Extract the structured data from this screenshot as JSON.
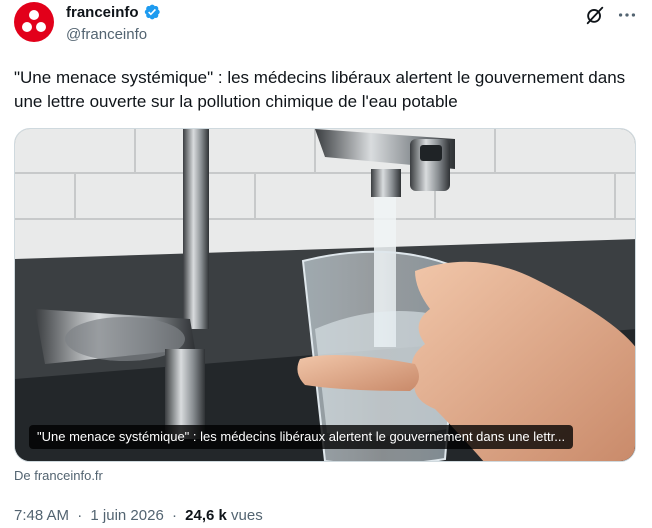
{
  "account": {
    "name": "franceinfo",
    "handle": "@franceinfo",
    "avatar_color": "#e2001a",
    "verified_color": "#1d9bf0"
  },
  "header_icons": [
    "grok-icon",
    "more-icon"
  ],
  "tweet": {
    "text": "\"Une menace systémique\" : les médecins libéraux alertent le gouvernement dans une lettre ouverte sur la pollution chimique de l'eau potable"
  },
  "media": {
    "caption": "\"Une menace systémique\" : les médecins libéraux alertent le gouvernement dans une lettr..."
  },
  "source": "De franceinfo.fr",
  "meta": {
    "time": "7:48 AM",
    "separator": "·",
    "date": "1 juin 2026",
    "views_count": "24,6 k",
    "views_label": "vues"
  }
}
